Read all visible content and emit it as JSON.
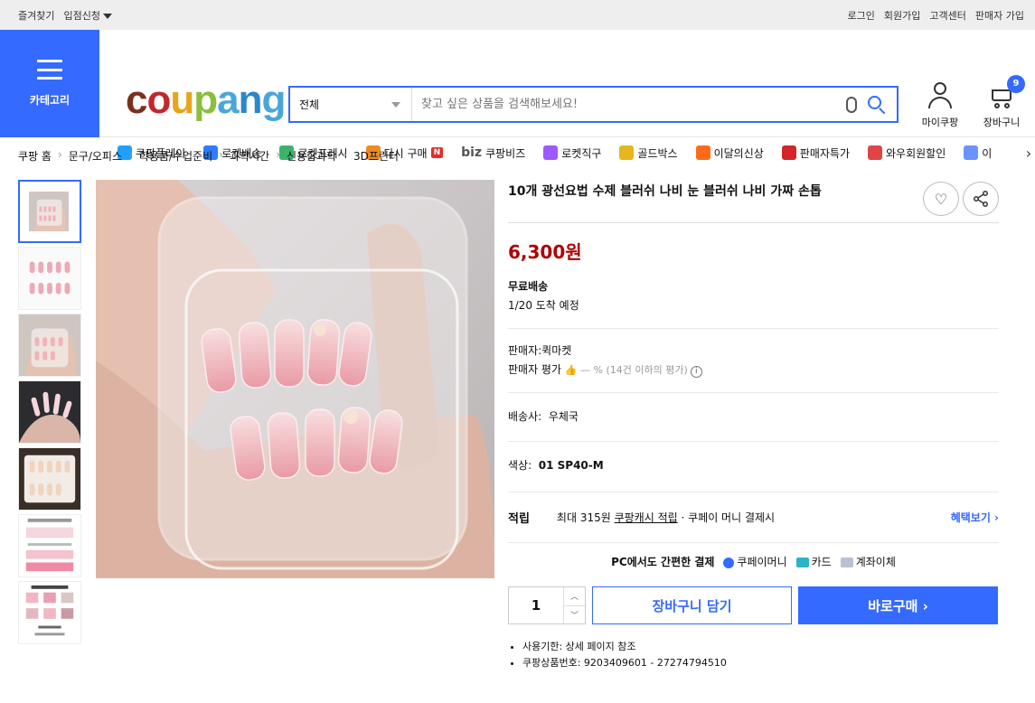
{
  "topbar": {
    "left": [
      "즐겨찾기",
      "입점신청"
    ],
    "right": [
      "로그인",
      "회원가입",
      "고객센터",
      "판매자 가입"
    ]
  },
  "category": {
    "label": "카테고리"
  },
  "logo": {
    "text": "coupang"
  },
  "search": {
    "select": "전체",
    "placeholder": "찾고 싶은 상품을 검색해보세요!"
  },
  "mycoupang": {
    "label": "마이쿠팡"
  },
  "cart": {
    "label": "장바구니",
    "count": "9"
  },
  "nav": [
    {
      "label": "쿠팡플레이",
      "color": "#1fa0ff"
    },
    {
      "label": "로켓배송",
      "color": "#2e7cff"
    },
    {
      "label": "로켓프레시",
      "color": "#3bb36d"
    },
    {
      "label": "다시 구매",
      "color": "#f08a24",
      "badge": "N"
    },
    {
      "label": "쿠팡비즈",
      "prefix": "biz"
    },
    {
      "label": "로켓직구",
      "color": "#9b59ff"
    },
    {
      "label": "골드박스",
      "color": "#e7b51c"
    },
    {
      "label": "이달의신상",
      "color": "#ff6a1a"
    },
    {
      "label": "판매자특가",
      "color": "#d3262b"
    },
    {
      "label": "와우회원할인",
      "color": "#e04444"
    },
    {
      "label": "이",
      "color": "#6a93ff"
    }
  ],
  "breadcrumb": [
    "쿠팡 홈",
    "문구/오피스",
    "학용품/수업준비",
    "과학시간",
    "신용합과학",
    "3D프린터"
  ],
  "product": {
    "title": "10개 광선요법 수제 블러쉬 나비 눈 블러쉬 나비 가짜 손톱",
    "price": "6,300원",
    "shipping_label": "무료배송",
    "arrival": "1/20 도착 예정",
    "seller": "판매자:퀵마켓",
    "rating_label": "판매자 평가",
    "rating_value": "— % (14건 이하의 평가)",
    "courier_label": "배송사:",
    "courier": "우체국",
    "color_label": "색상:",
    "color": "01 SP40-M",
    "points_label": "적립",
    "points_max": "최대 315원",
    "points_link": "쿠팡캐시 적립",
    "points_suffix": "· 쿠페이 머니 결제시",
    "benefit": "혜택보기 ›",
    "pay_title": "PC에서도 간편한 결제",
    "pay_options": [
      "쿠페이머니",
      "카드",
      "계좌이체"
    ],
    "quantity": "1",
    "add_cart": "장바구니 담기",
    "buy_now": "바로구매 ›",
    "notes": [
      "사용기한: 상세 페이지 참조",
      "쿠팡상품번호: 9203409601 - 27274794510"
    ]
  },
  "colors": {
    "accent": "#346aff",
    "price": "#ae0000"
  }
}
